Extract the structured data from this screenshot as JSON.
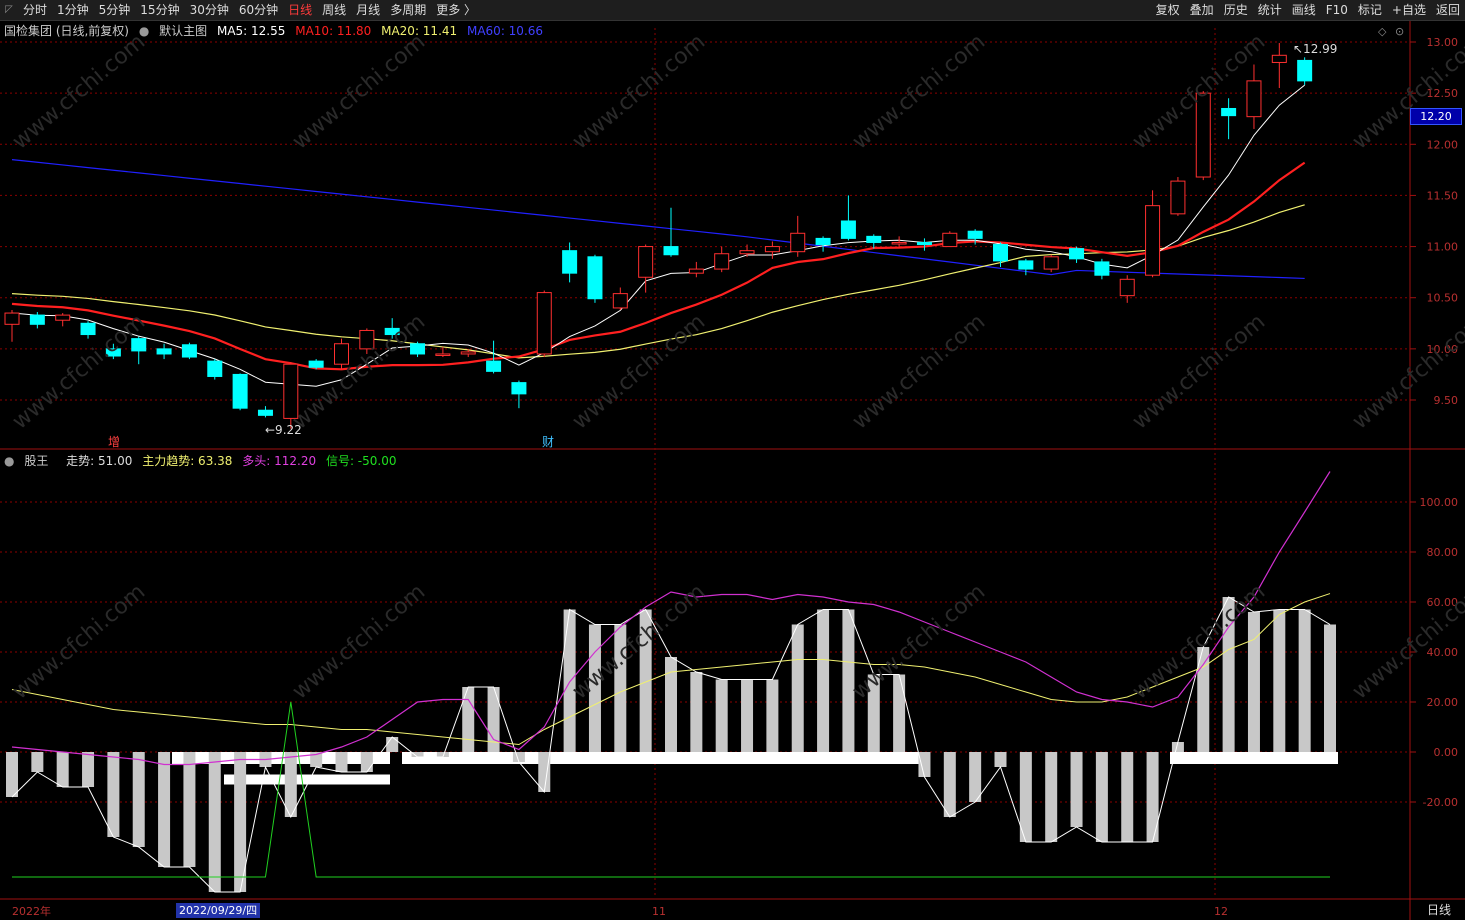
{
  "toolbar": {
    "left": [
      "分时",
      "1分钟",
      "5分钟",
      "15分钟",
      "30分钟",
      "60分钟",
      "日线",
      "周线",
      "月线",
      "多周期",
      "更多 〉"
    ],
    "active": "日线",
    "right": [
      "复权",
      "叠加",
      "历史",
      "统计",
      "画线",
      "F10",
      "标记",
      "+自选",
      "返回"
    ]
  },
  "main_legend": {
    "title": "国检集团 (日线,前复权)",
    "indicator": "默认主图",
    "ma5": "MA5: 12.55",
    "ma10": "MA10: 11.80",
    "ma20": "MA20: 11.41",
    "ma60": "MA60: 10.66"
  },
  "sub_legend": {
    "name": "股王",
    "zoushi": "走势: 51.00",
    "zhuli": "主力趋势: 63.38",
    "duotou": "多头: 112.20",
    "xinhao": "信号: -50.00"
  },
  "markers": {
    "high": "12.99",
    "low": "9.22",
    "zeng": "增",
    "cai": "财"
  },
  "current_price": "12.20",
  "bottom": {
    "year": "2022年",
    "date": "2022/09/29/四",
    "m11": "11",
    "m12": "12",
    "period": "日线"
  },
  "colors": {
    "ma5": "#ffffff",
    "ma10": "#ff2020",
    "ma20": "#f0f070",
    "ma60": "#2020ff",
    "up": "#ff3030",
    "down": "#00ffff",
    "grid": "#8b0000",
    "purple": "#d030d0",
    "green": "#20d020"
  },
  "chart_data": [
    {
      "type": "candlestick",
      "title": "国检集团 (日线,前复权)",
      "y_ticks": [
        13.0,
        12.5,
        12.0,
        11.5,
        11.0,
        10.5,
        10.0,
        9.5
      ],
      "ylim": [
        9.05,
        13.1
      ],
      "candles": [
        [
          10.24,
          10.35,
          10.38,
          10.07
        ],
        [
          10.33,
          10.24,
          10.36,
          10.2
        ],
        [
          10.28,
          10.33,
          10.35,
          10.22
        ],
        [
          10.25,
          10.14,
          10.27,
          10.1
        ],
        [
          10.0,
          9.93,
          10.05,
          9.9
        ],
        [
          10.1,
          9.98,
          10.12,
          9.85
        ],
        [
          10.0,
          9.95,
          10.05,
          9.9
        ],
        [
          10.04,
          9.92,
          10.06,
          9.9
        ],
        [
          9.88,
          9.73,
          9.9,
          9.7
        ],
        [
          9.75,
          9.42,
          9.76,
          9.4
        ],
        [
          9.4,
          9.35,
          9.44,
          9.33
        ],
        [
          9.32,
          9.85,
          9.87,
          9.22
        ],
        [
          9.88,
          9.82,
          9.9,
          9.8
        ],
        [
          9.85,
          10.05,
          10.1,
          9.8
        ],
        [
          10.0,
          10.18,
          10.2,
          9.95
        ],
        [
          10.2,
          10.14,
          10.3,
          10.1
        ],
        [
          10.05,
          9.95,
          10.07,
          9.92
        ],
        [
          9.95,
          9.95,
          10.02,
          9.92
        ],
        [
          9.95,
          9.97,
          10.0,
          9.92
        ],
        [
          9.88,
          9.78,
          10.08,
          9.76
        ],
        [
          9.67,
          9.56,
          9.69,
          9.42
        ],
        [
          9.95,
          10.55,
          10.57,
          9.92
        ],
        [
          10.96,
          10.74,
          11.04,
          10.65
        ],
        [
          10.9,
          10.49,
          10.92,
          10.45
        ],
        [
          10.4,
          10.54,
          10.6,
          10.38
        ],
        [
          10.7,
          11.0,
          11.02,
          10.55
        ],
        [
          11.0,
          10.92,
          11.38,
          10.9
        ],
        [
          10.74,
          10.78,
          10.85,
          10.7
        ],
        [
          10.78,
          10.93,
          11.0,
          10.75
        ],
        [
          10.93,
          10.96,
          11.02,
          10.9
        ],
        [
          10.95,
          11.0,
          11.05,
          10.88
        ],
        [
          10.95,
          11.13,
          11.3,
          10.9
        ],
        [
          11.08,
          11.02,
          11.1,
          10.95
        ],
        [
          11.25,
          11.08,
          11.5,
          11.06
        ],
        [
          11.1,
          11.04,
          11.12,
          10.98
        ],
        [
          11.04,
          11.04,
          11.1,
          11.0
        ],
        [
          11.04,
          11.02,
          11.08,
          10.96
        ],
        [
          11.0,
          11.13,
          11.15,
          11.0
        ],
        [
          11.15,
          11.08,
          11.17,
          11.02
        ],
        [
          11.02,
          10.86,
          11.04,
          10.8
        ],
        [
          10.86,
          10.78,
          10.88,
          10.72
        ],
        [
          10.78,
          10.9,
          10.92,
          10.75
        ],
        [
          10.98,
          10.88,
          11.0,
          10.84
        ],
        [
          10.85,
          10.72,
          10.88,
          10.68
        ],
        [
          10.52,
          10.68,
          10.72,
          10.45
        ],
        [
          10.72,
          11.4,
          11.55,
          10.7
        ],
        [
          11.32,
          11.64,
          11.68,
          11.3
        ],
        [
          11.68,
          12.5,
          12.52,
          11.65
        ],
        [
          12.35,
          12.28,
          12.45,
          12.05
        ],
        [
          12.27,
          12.62,
          12.78,
          12.15
        ],
        [
          12.8,
          12.87,
          12.99,
          12.55
        ],
        [
          12.82,
          12.62,
          12.85,
          12.58
        ]
      ]
    },
    {
      "type": "bar",
      "title": "股王",
      "y_ticks": [
        100.0,
        80.0,
        60.0,
        40.0,
        20.0,
        0.0,
        -20.0
      ],
      "ylim": [
        -60,
        120
      ],
      "values": [
        -18,
        -8,
        -14,
        -14,
        -34,
        -38,
        -46,
        -46,
        -56,
        -56,
        -6,
        -26,
        -6,
        -8,
        -8,
        6,
        -2,
        -2,
        26,
        26,
        -4,
        -16,
        57,
        51,
        51,
        57,
        38,
        32,
        29,
        29,
        29,
        51,
        57,
        57,
        31,
        31,
        -10,
        -26,
        -20,
        -6,
        -36,
        -36,
        -30,
        -36,
        -36,
        -36,
        4,
        42,
        62,
        56,
        57,
        57,
        51
      ],
      "bands": [
        [
          172,
          390,
          -3,
          -9
        ],
        [
          402,
          928,
          -3,
          0
        ],
        [
          1170,
          1338,
          -3,
          0
        ]
      ],
      "zhuli_trend": [
        25,
        23,
        21,
        19,
        17,
        16,
        15,
        14,
        13,
        12,
        11,
        11,
        10,
        9,
        9,
        8,
        7,
        6,
        5,
        4,
        3,
        9,
        14,
        19,
        24,
        28,
        32,
        33,
        34,
        35,
        36,
        37,
        37,
        36,
        35,
        35,
        34,
        32,
        30,
        27,
        24,
        21,
        20,
        20,
        22,
        26,
        30,
        34,
        41,
        45,
        55,
        60,
        63.38
      ],
      "duotou": [
        2,
        1,
        0,
        -1,
        -2,
        -3,
        -5,
        -5,
        -4,
        -3,
        -3,
        -2,
        -1,
        2,
        6,
        13,
        20,
        21,
        21,
        5,
        1,
        10,
        28,
        40,
        50,
        58,
        64,
        62,
        63,
        63,
        61,
        63,
        62,
        60,
        59,
        56,
        52,
        48,
        44,
        40,
        36,
        30,
        24,
        21,
        20,
        18,
        22,
        35,
        50,
        62,
        80,
        96,
        112.2
      ],
      "signal_line": [
        -50,
        -50,
        -50,
        -50,
        -50,
        -50,
        -50,
        -50,
        -50,
        -50,
        -50,
        20,
        -50,
        -50,
        -50,
        -50,
        -50,
        -50,
        -50,
        -50,
        -50,
        -50,
        -50,
        -50,
        -50,
        -50,
        -50,
        -50,
        -50,
        -50,
        -50,
        -50,
        -50,
        -50,
        -50,
        -50,
        -50,
        -50,
        -50,
        -50,
        -50,
        -50,
        -50,
        -50,
        -50,
        -50,
        -50,
        -50,
        -50,
        -50,
        -50,
        -50,
        -50
      ]
    }
  ]
}
